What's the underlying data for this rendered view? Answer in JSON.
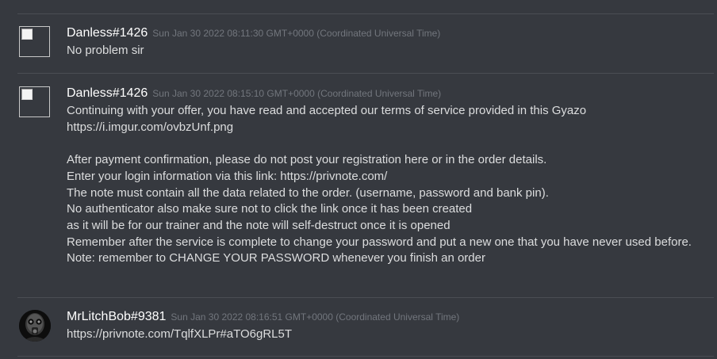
{
  "messages": [
    {
      "username": "Danless#1426",
      "timestamp": "Sun Jan 30 2022 08:11:30 GMT+0000 (Coordinated Universal Time)",
      "content": "No problem sir"
    },
    {
      "username": "Danless#1426",
      "timestamp": "Sun Jan 30 2022 08:15:10 GMT+0000 (Coordinated Universal Time)",
      "content": "Continuing with your offer, you have read and accepted our terms of service provided in this Gyazo\nhttps://i.imgur.com/ovbzUnf.png\n\nAfter payment confirmation, please do not post your registration here or in the order details.\nEnter your login information via this link: https://privnote.com/\nThe note must contain all the data related to the order. (username, password and bank pin).\nNo authenticator also make sure not to click the link once it has been created\nas it will be for our trainer and the note will self-destruct once it is opened\nRemember after the service is complete to change your password and put a new one that you have never used before.\nNote: remember to CHANGE YOUR PASSWORD whenever you finish an order"
    },
    {
      "username": "MrLitchBob#9381",
      "timestamp": "Sun Jan 30 2022 08:16:51 GMT+0000 (Coordinated Universal Time)",
      "content": "https://privnote.com/TqlfXLPr#aTO6gRL5T"
    }
  ],
  "icons": {
    "avatar_1": "broken-image-icon",
    "avatar_2": "broken-image-icon",
    "avatar_3": "gas-mask-avatar-icon"
  },
  "colors": {
    "background": "#36393f",
    "username": "#ffffff",
    "content": "#dcddde",
    "timestamp": "#72767d",
    "divider": "#4a4d53"
  }
}
